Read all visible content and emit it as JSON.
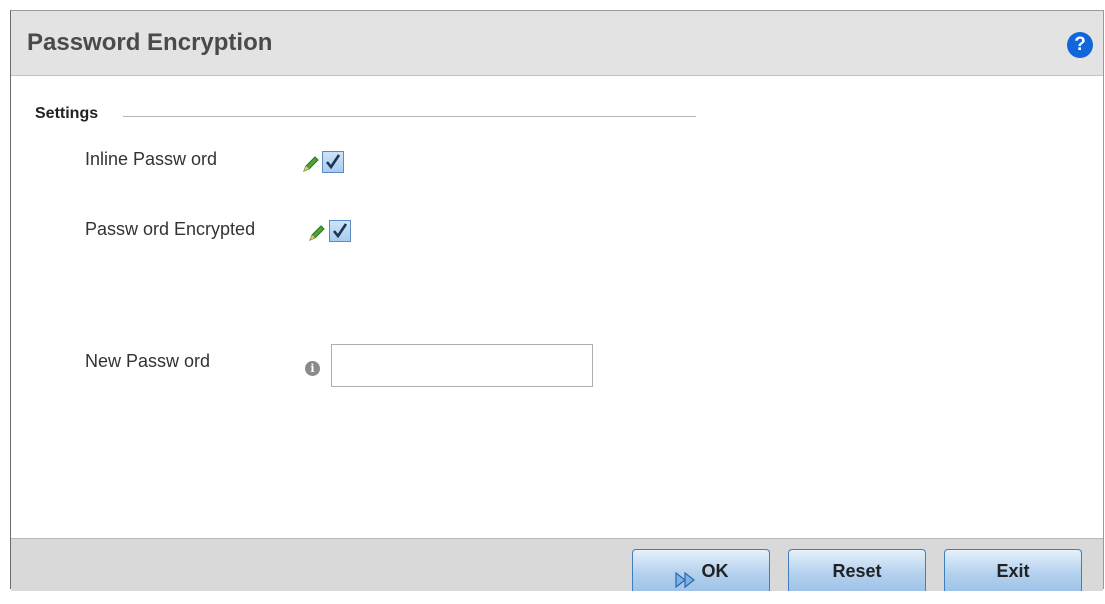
{
  "dialog": {
    "title": "Password Encryption",
    "help_icon": "help-icon",
    "help_glyph": "?"
  },
  "settings": {
    "section_label": "Settings",
    "fields": [
      {
        "label": "Inline Passw ord",
        "icon": "pencil-icon",
        "checked": true
      },
      {
        "label": "Passw ord Encrypted",
        "icon": "pencil-icon",
        "checked": true
      }
    ],
    "new_password": {
      "label": "New  Passw ord",
      "info_icon": "info-icon",
      "info_glyph": "i",
      "value": ""
    }
  },
  "footer": {
    "ok_label": "OK",
    "ok_icon": "ok-arrow-icon",
    "reset_label": "Reset",
    "exit_label": "Exit"
  },
  "colors": {
    "title_bar": "#e3e3e3",
    "help_icon": "#1166d9",
    "button_border": "#3f7fbf",
    "footer": "#d9d9d9"
  }
}
